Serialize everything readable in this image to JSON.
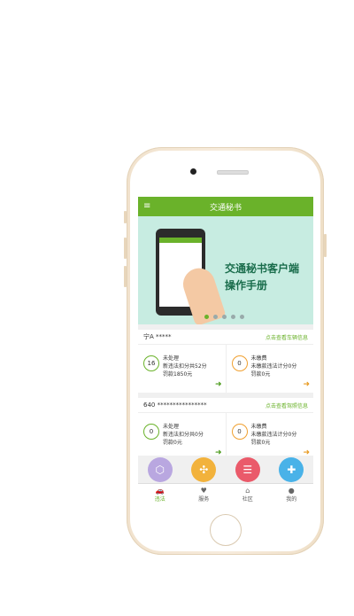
{
  "app": {
    "title": "交通秘书"
  },
  "banner": {
    "line1": "交通秘书客户端",
    "line2": "操作手册"
  },
  "vehicles": [
    {
      "plate": "宁A *****",
      "link": "点击查看车辆信息",
      "pending": {
        "count": "16",
        "title": "未处理",
        "line1": "新违法扣分共52分",
        "line2": "罚款1850元"
      },
      "unpaid": {
        "count": "0",
        "title": "未缴费",
        "line1": "未缴款违法计分0分",
        "line2": "罚款0元"
      }
    },
    {
      "plate": "640 ****************",
      "link": "点击查看驾照信息",
      "pending": {
        "count": "0",
        "title": "未处理",
        "line1": "新违法扣分共0分",
        "line2": "罚款0元"
      },
      "unpaid": {
        "count": "0",
        "title": "未缴费",
        "line1": "未缴款违法计分0分",
        "line2": "罚款0元"
      }
    }
  ],
  "tabs": [
    {
      "label": "违法",
      "icon": "car-icon"
    },
    {
      "label": "服务",
      "icon": "heart-icon"
    },
    {
      "label": "社区",
      "icon": "community-icon"
    },
    {
      "label": "我的",
      "icon": "person-icon"
    }
  ],
  "colors": {
    "brand": "#6ab22a",
    "accent_orange": "#f0a030"
  }
}
